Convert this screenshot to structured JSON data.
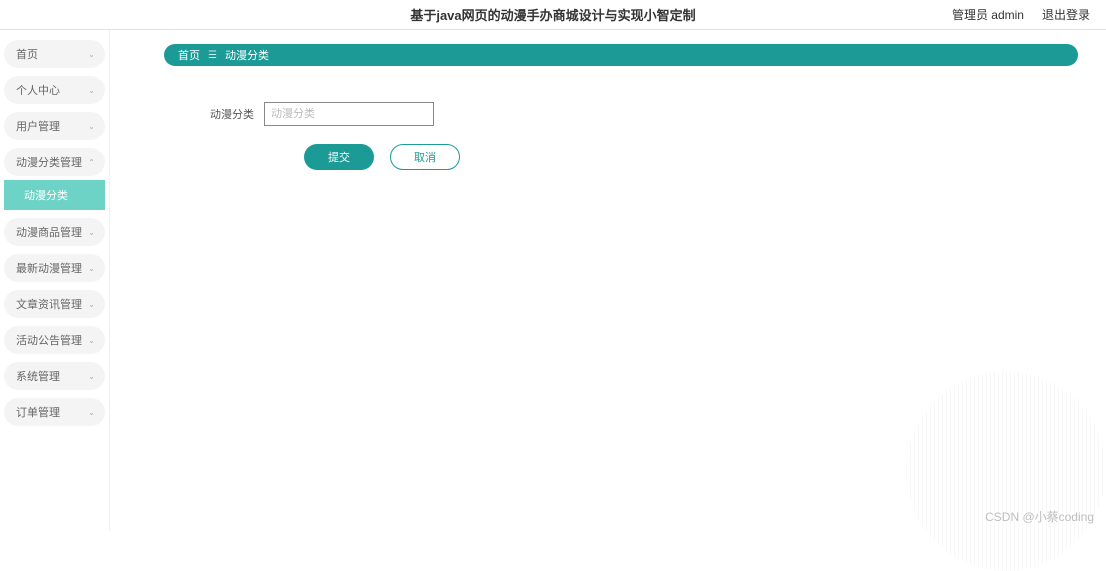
{
  "header": {
    "title": "基于java网页的动漫手办商城设计与实现小智定制",
    "admin_label": "管理员 admin",
    "logout_label": "退出登录"
  },
  "sidebar": {
    "items": [
      {
        "label": "首页",
        "expandable": true
      },
      {
        "label": "个人中心",
        "expandable": true
      },
      {
        "label": "用户管理",
        "expandable": true
      },
      {
        "label": "动漫分类管理",
        "expandable": true,
        "expanded": true,
        "sub": {
          "label": "动漫分类"
        }
      },
      {
        "label": "动漫商品管理",
        "expandable": true
      },
      {
        "label": "最新动漫管理",
        "expandable": true
      },
      {
        "label": "文章资讯管理",
        "expandable": true
      },
      {
        "label": "活动公告管理",
        "expandable": true
      },
      {
        "label": "系统管理",
        "expandable": true
      },
      {
        "label": "订单管理",
        "expandable": true
      }
    ]
  },
  "breadcrumb": {
    "home": "首页",
    "current": "动漫分类"
  },
  "form": {
    "field_label": "动漫分类",
    "placeholder": "动漫分类",
    "value": "",
    "submit_label": "提交",
    "cancel_label": "取消"
  },
  "watermark": "CSDN @小蔡coding"
}
